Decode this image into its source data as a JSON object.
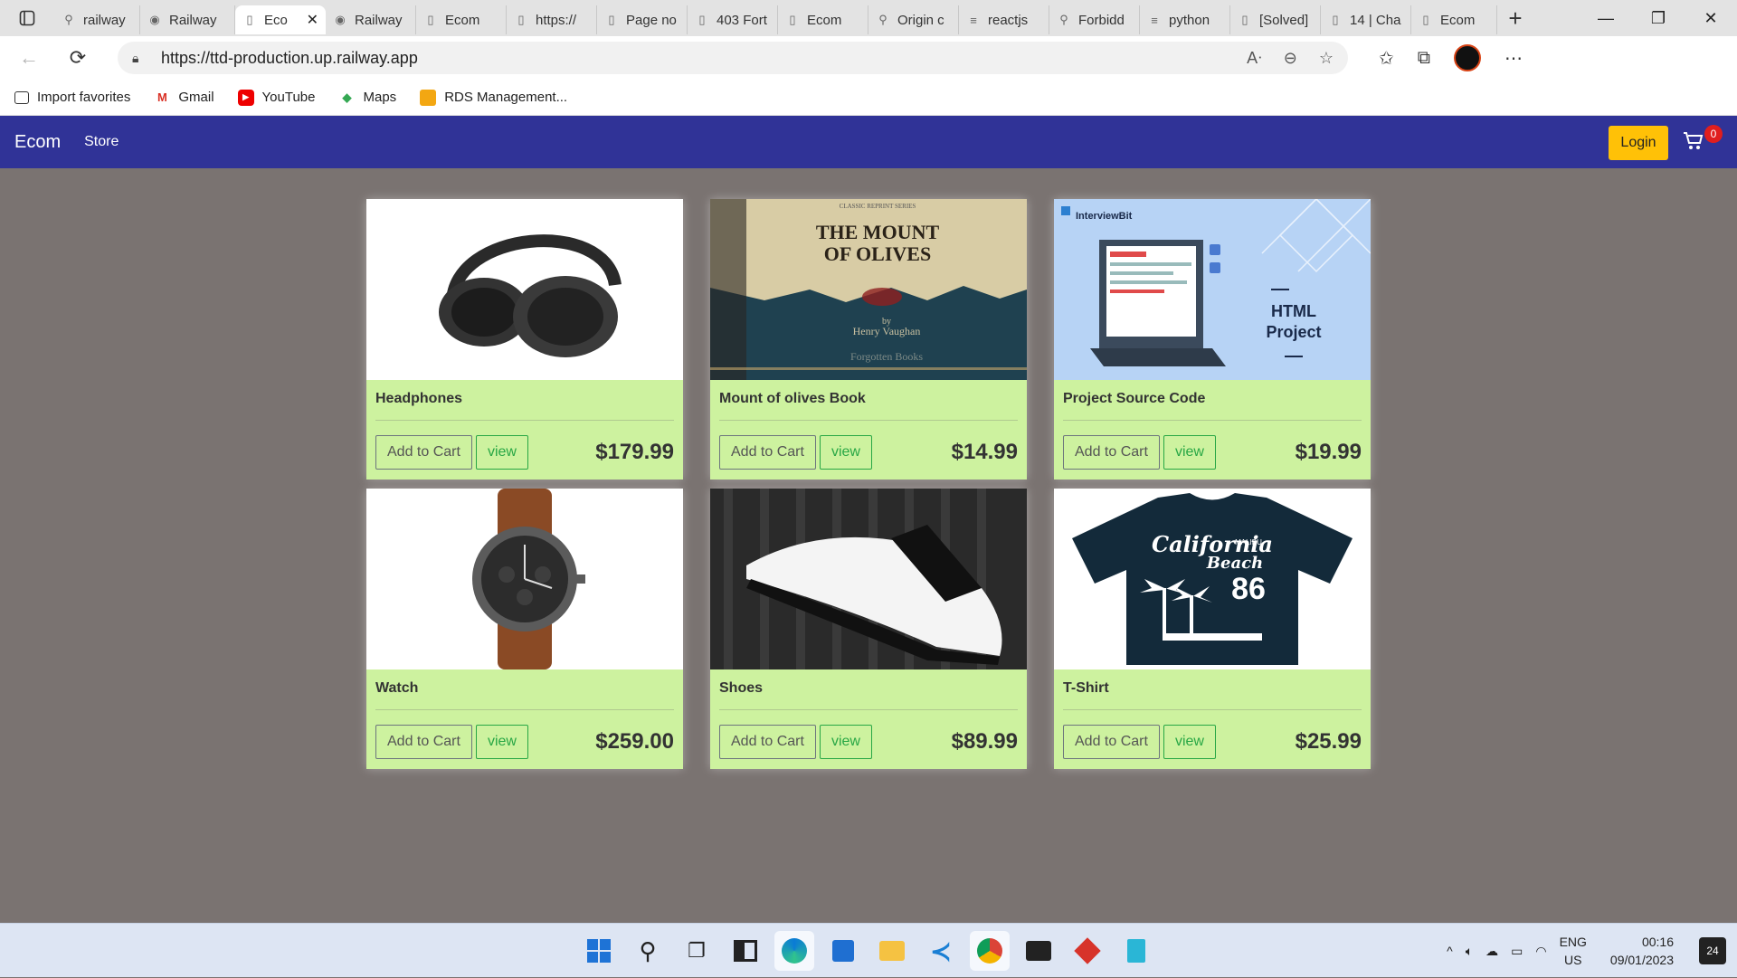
{
  "browser": {
    "tabs": [
      {
        "label": "railway",
        "icon": "search-icon"
      },
      {
        "label": "Railway",
        "icon": "railway-icon"
      },
      {
        "label": "Eco",
        "icon": "page-icon",
        "active": true
      },
      {
        "label": "Railway",
        "icon": "railway-icon"
      },
      {
        "label": "Ecom",
        "icon": "page-icon"
      },
      {
        "label": "https://",
        "icon": "page-icon"
      },
      {
        "label": "Page no",
        "icon": "page-icon"
      },
      {
        "label": "403 Fort",
        "icon": "page-icon"
      },
      {
        "label": "Ecom",
        "icon": "page-icon"
      },
      {
        "label": "Origin c",
        "icon": "search-icon"
      },
      {
        "label": "reactjs",
        "icon": "stack-icon"
      },
      {
        "label": "Forbidd",
        "icon": "search-icon"
      },
      {
        "label": "python",
        "icon": "stack-icon"
      },
      {
        "label": "[Solved]",
        "icon": "page-icon"
      },
      {
        "label": "14 | Cha",
        "icon": "page-icon"
      },
      {
        "label": "Ecom",
        "icon": "page-icon"
      }
    ],
    "url": "https://ttd-production.up.railway.app",
    "favorites": [
      {
        "label": "Import favorites",
        "icon": "import-icon"
      },
      {
        "label": "Gmail",
        "icon": "gmail-icon"
      },
      {
        "label": "YouTube",
        "icon": "youtube-icon"
      },
      {
        "label": "Maps",
        "icon": "maps-icon"
      },
      {
        "label": "RDS Management...",
        "icon": "rds-icon"
      }
    ]
  },
  "site": {
    "brand": "Ecom",
    "store_link": "Store",
    "login_label": "Login",
    "cart_count": "0"
  },
  "products": [
    {
      "name": "Headphones",
      "price": "$179.99",
      "add_label": "Add to Cart",
      "view_label": "view"
    },
    {
      "name": "Mount of olives Book",
      "price": "$14.99",
      "add_label": "Add to Cart",
      "view_label": "view",
      "image_text": {
        "series": "CLASSIC REPRINT SERIES",
        "title1": "THE MOUNT",
        "title2": "OF OLIVES",
        "by": "by",
        "author": "Henry Vaughan",
        "publisher": "Forgotten Books"
      }
    },
    {
      "name": "Project Source Code",
      "price": "$19.99",
      "add_label": "Add to Cart",
      "view_label": "view",
      "image_text": {
        "brand": "InterviewBit",
        "line1": "HTML",
        "line2": "Project"
      }
    },
    {
      "name": "Watch",
      "price": "$259.00",
      "add_label": "Add to Cart",
      "view_label": "view"
    },
    {
      "name": "Shoes",
      "price": "$89.99",
      "add_label": "Add to Cart",
      "view_label": "view"
    },
    {
      "name": "T-Shirt",
      "price": "$25.99",
      "add_label": "Add to Cart",
      "view_label": "view",
      "image_text": {
        "line1": "California",
        "line2": "Beach",
        "small": "MALIBU",
        "number": "86"
      }
    }
  ],
  "taskbar": {
    "lang": "ENG",
    "region": "US",
    "time": "00:16",
    "date": "09/01/2023",
    "notifications": "24"
  }
}
